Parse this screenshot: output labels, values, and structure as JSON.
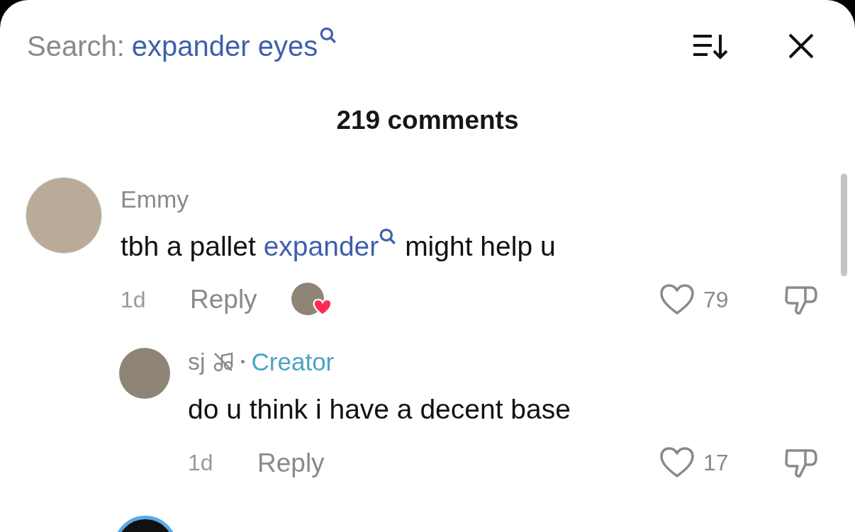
{
  "search": {
    "label": "Search:",
    "query": "expander eyes"
  },
  "comment_count": "219 comments",
  "comments": [
    {
      "author": "Emmy",
      "is_creator": false,
      "segments": [
        {
          "kind": "plain",
          "text": "tbh a pallet "
        },
        {
          "kind": "search_link",
          "text": "expander"
        },
        {
          "kind": "plain",
          "text": " might help u"
        }
      ],
      "age": "1d",
      "reply_label": "Reply",
      "liked_by_creator": true,
      "likes": "79",
      "liked": false,
      "children": [
        {
          "author": "sj",
          "is_creator": true,
          "badge": "Creator",
          "segments": [
            {
              "kind": "plain",
              "text": "do u think i have a decent base"
            }
          ],
          "age": "1d",
          "reply_label": "Reply",
          "liked_by_creator": false,
          "likes": "17",
          "liked": false
        }
      ]
    }
  ]
}
